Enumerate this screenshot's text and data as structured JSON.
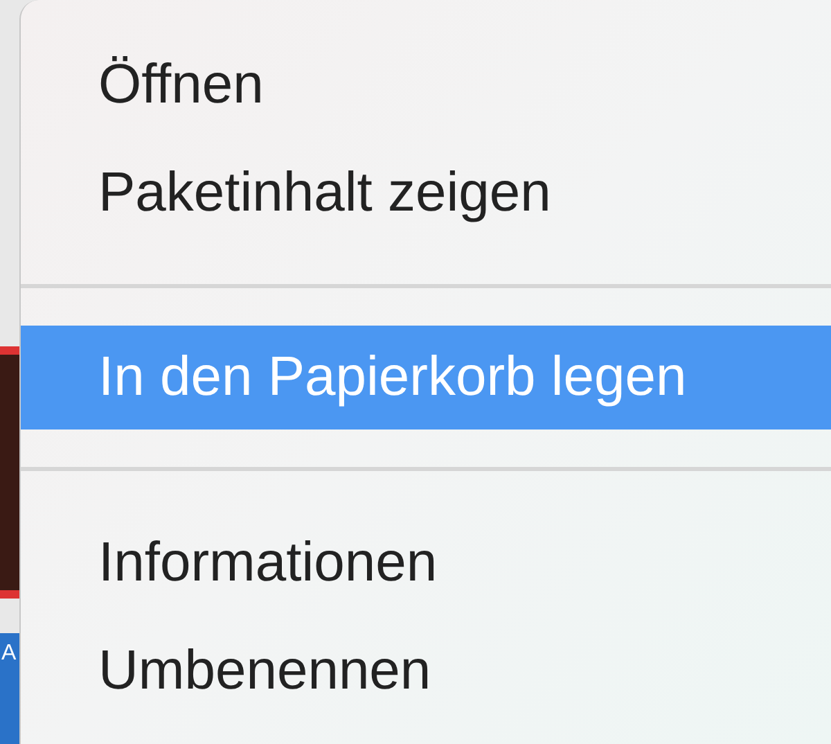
{
  "menu": {
    "items": [
      {
        "kind": "item",
        "label": "Öffnen",
        "selected": false
      },
      {
        "kind": "item",
        "label": "Paketinhalt zeigen",
        "selected": false
      },
      {
        "kind": "separator"
      },
      {
        "kind": "item",
        "label": "In den Papierkorb legen",
        "selected": true
      },
      {
        "kind": "separator"
      },
      {
        "kind": "item",
        "label": "Informationen",
        "selected": false
      },
      {
        "kind": "item",
        "label": "Umbenennen",
        "selected": false
      }
    ]
  },
  "background": {
    "label": "A"
  }
}
